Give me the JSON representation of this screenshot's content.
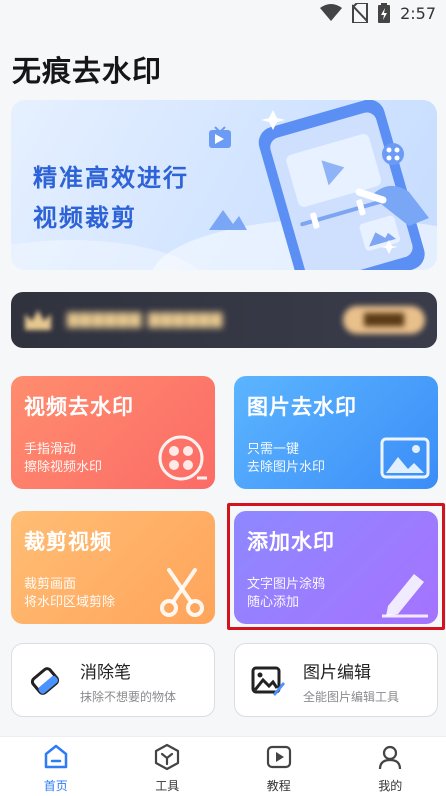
{
  "status_bar": {
    "time": "2:57"
  },
  "app": {
    "title": "无痕去水印"
  },
  "banner": {
    "line1": "精准高效进行",
    "line2": "视频裁剪"
  },
  "colors": {
    "accent": "#2d7cf6",
    "highlight": "#d3141e"
  },
  "feature_cards": [
    {
      "title": "视频去水印",
      "sub1": "手指滑动",
      "sub2": "擦除视频水印",
      "icon": "film-reel-icon"
    },
    {
      "title": "图片去水印",
      "sub1": "只需一键",
      "sub2": "去除图片水印",
      "icon": "image-icon"
    },
    {
      "title": "裁剪视频",
      "sub1": "裁剪画面",
      "sub2": "将水印区域剪除",
      "icon": "scissors-icon"
    },
    {
      "title": "添加水印",
      "sub1": "文字图片涂鸦",
      "sub2": "随心添加",
      "icon": "pen-icon"
    }
  ],
  "tools": [
    {
      "title": "消除笔",
      "sub": "抹除不想要的物体",
      "icon": "eraser-icon"
    },
    {
      "title": "图片编辑",
      "sub": "全能图片编辑工具",
      "icon": "image-edit-icon"
    }
  ],
  "tabs": [
    {
      "label": "首页",
      "icon": "home-icon",
      "active": true
    },
    {
      "label": "工具",
      "icon": "tools-icon",
      "active": false
    },
    {
      "label": "教程",
      "icon": "play-tutorial-icon",
      "active": false
    },
    {
      "label": "我的",
      "icon": "user-icon",
      "active": false
    }
  ]
}
